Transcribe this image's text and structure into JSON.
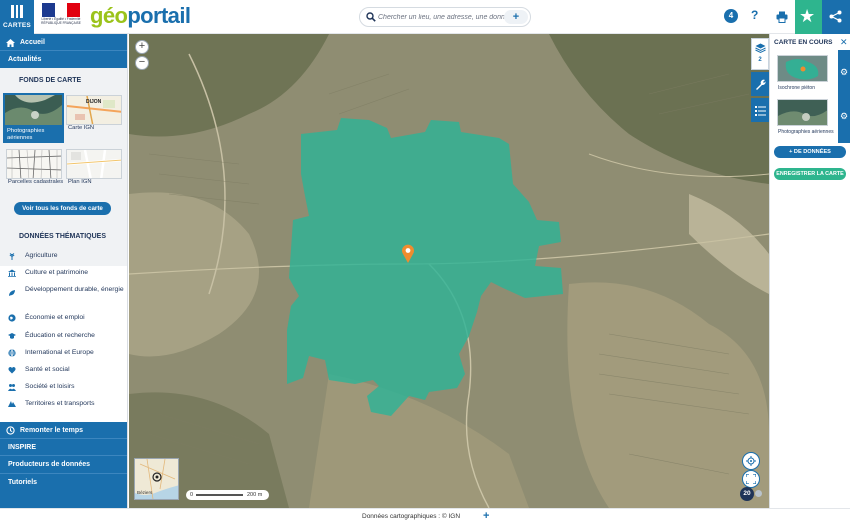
{
  "header": {
    "menu_label": "CARTES",
    "logo_text": "Liberté • Égalité • Fraternité RÉPUBLIQUE FRANÇAISE",
    "brand_part1": "géo",
    "brand_part2": "portail",
    "search_placeholder": "Chercher un lieu, une adresse, une donnée",
    "search_add": "+",
    "notification_count": "4",
    "help_label": "?"
  },
  "sidebar": {
    "accueil": "Accueil",
    "actualites": "Actualités",
    "fonds_title": "FONDS DE CARTE",
    "backgrounds": [
      {
        "label": "Photographies aériennes",
        "thumb_text": ""
      },
      {
        "label": "Carte IGN",
        "thumb_text": "DIJON"
      },
      {
        "label": "Parcelles cadastrales",
        "thumb_text": ""
      },
      {
        "label": "Plan IGN",
        "thumb_text": ""
      }
    ],
    "voir_tous": "Voir tous les fonds de carte",
    "themes_title": "DONNÉES THÉMATIQUES",
    "themes": [
      {
        "label": "Agriculture",
        "icon": "wheat-icon"
      },
      {
        "label": "Culture et patrimoine",
        "icon": "museum-icon"
      },
      {
        "label": "Développement durable, énergie",
        "icon": "energy-icon"
      },
      {
        "label": "Économie et emploi",
        "icon": "globe-icon"
      },
      {
        "label": "Éducation et recherche",
        "icon": "graduation-icon"
      },
      {
        "label": "International et Europe",
        "icon": "world-icon"
      },
      {
        "label": "Santé et social",
        "icon": "health-icon"
      },
      {
        "label": "Société et loisirs",
        "icon": "society-icon"
      },
      {
        "label": "Territoires et transports",
        "icon": "transport-icon"
      }
    ],
    "remonter": "Remonter le temps",
    "inspire": "INSPIRE",
    "producteurs": "Producteurs de données",
    "tutoriels": "Tutoriels"
  },
  "map": {
    "zoom_in": "+",
    "zoom_out": "−",
    "overview_city": "Béziers",
    "scale_zero": "0",
    "scale_label": "200 m",
    "zoom_level": "20",
    "isochrone_color": "#2eb396",
    "marker_color": "#f08c2e"
  },
  "tools": {
    "layers_count": "2"
  },
  "right_panel": {
    "title": "CARTE EN COURS",
    "layers": [
      {
        "label": "Isochrone piéton"
      },
      {
        "label": "Photographies aériennes"
      }
    ],
    "add_data": "+ DE DONNÉES",
    "save": "ENREGISTRER LA CARTE"
  },
  "footer": {
    "attribution": "Données cartographiques : ©  IGN",
    "more": "+"
  },
  "colors": {
    "primary": "#1a6fad",
    "accent": "#2eb58e",
    "brand_green": "#9bc31b"
  }
}
